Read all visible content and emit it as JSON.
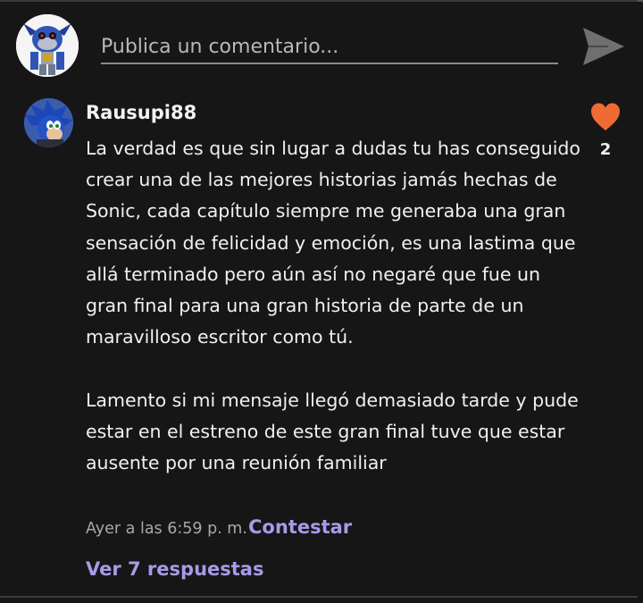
{
  "composer": {
    "placeholder": "Publica un comentario..."
  },
  "comment": {
    "author": "Rausupi88",
    "body_paragraphs": [
      "La verdad es que sin lugar a dudas tu has conseguido crear una de las mejores historias jamás hechas de Sonic, cada capítulo siempre me generaba una gran sensación de felicidad y emoción, es una lastima que allá terminado pero aún así no negaré que fue un gran final para una gran historia de parte de un maravilloso escritor como tú.",
      "Lamento si mi mensaje llegó demasiado tarde y pude estar en el estreno de este gran final tuve que estar ausente por una reunión familiar"
    ],
    "likes": "2",
    "timestamp": "Ayer a las 6:59 p. m.",
    "reply_label": "Contestar",
    "view_replies_label": "Ver 7 respuestas"
  },
  "icons": {
    "send": "send-icon",
    "like": "heart-icon"
  },
  "colors": {
    "background": "#161616",
    "accent": "#a99ae8",
    "heart": "#f06a34"
  }
}
